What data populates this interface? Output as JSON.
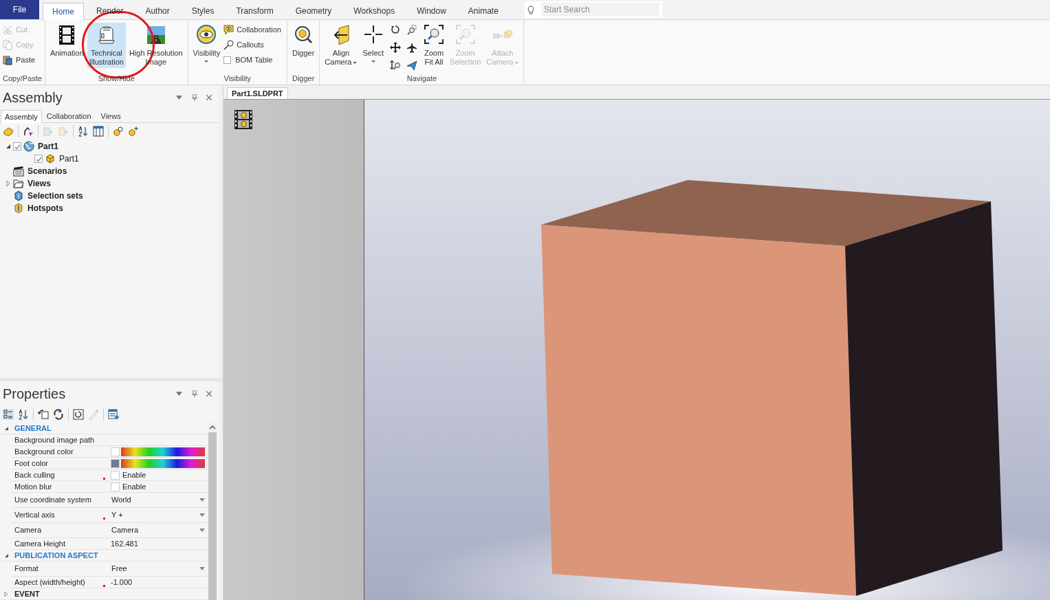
{
  "menu_tabs": [
    {
      "label": "File",
      "kind": "file"
    },
    {
      "label": "Home",
      "kind": "tab",
      "selected": true
    },
    {
      "label": "Render",
      "kind": "tab",
      "selected": false
    },
    {
      "label": "Author",
      "kind": "tab",
      "selected": false
    },
    {
      "label": "Styles",
      "kind": "tab",
      "selected": false
    },
    {
      "label": "Transform",
      "kind": "tab",
      "selected": false
    },
    {
      "label": "Geometry",
      "kind": "tab",
      "selected": false
    },
    {
      "label": "Workshops",
      "kind": "tab",
      "selected": false
    },
    {
      "label": "Window",
      "kind": "tab",
      "selected": false
    },
    {
      "label": "Animate",
      "kind": "tab",
      "selected": false
    }
  ],
  "search": {
    "placeholder": "Start Search"
  },
  "ribbon_groups": [
    {
      "label": "Copy/Paste",
      "items": [
        {
          "kind": "small",
          "label": "Cut",
          "disabled": true
        },
        {
          "kind": "small",
          "label": "Copy",
          "disabled": true
        },
        {
          "kind": "small",
          "label": "Paste",
          "disabled": false
        }
      ]
    },
    {
      "label": "Show/Hide",
      "items": [
        {
          "kind": "large",
          "label": "Animation",
          "disabled": false,
          "selected": false,
          "dropdown": false
        },
        {
          "kind": "large",
          "label": "Technical\nIllustration",
          "disabled": false,
          "selected": true,
          "dropdown": false
        },
        {
          "kind": "large",
          "label": "High Resolution\nImage",
          "disabled": false,
          "selected": false,
          "dropdown": false
        }
      ]
    },
    {
      "label": "Visibility",
      "items": [
        {
          "kind": "large",
          "label": "Visibility",
          "disabled": false,
          "selected": false,
          "dropdown": true
        },
        {
          "kind": "small",
          "label": "Collaboration",
          "disabled": false
        },
        {
          "kind": "small",
          "label": "Callouts",
          "disabled": false
        },
        {
          "kind": "checkbox",
          "label": "BOM Table",
          "checked": false
        }
      ]
    },
    {
      "label": "Digger",
      "items": [
        {
          "kind": "large",
          "label": "Digger",
          "disabled": false,
          "selected": false,
          "dropdown": false
        }
      ]
    },
    {
      "label": "Navigate",
      "items": [
        {
          "kind": "large",
          "label": "Align\nCamera",
          "disabled": false,
          "selected": false,
          "dropdown": true
        },
        {
          "kind": "large",
          "label": "Select",
          "disabled": false,
          "selected": false,
          "dropdown": true
        },
        {
          "kind": "tool-grid"
        },
        {
          "kind": "large",
          "label": "Zoom\nFit All",
          "disabled": false,
          "selected": false,
          "dropdown": false
        },
        {
          "kind": "large",
          "label": "Zoom\nSelection",
          "disabled": true,
          "selected": false,
          "dropdown": false
        },
        {
          "kind": "large",
          "label": "Attach\nCamera",
          "disabled": true,
          "selected": false,
          "dropdown": true
        }
      ]
    }
  ],
  "assembly_panel": {
    "title": "Assembly",
    "tabs": [
      {
        "label": "Assembly",
        "selected": true
      },
      {
        "label": "Collaboration",
        "selected": false
      },
      {
        "label": "Views",
        "selected": false
      }
    ],
    "tree": [
      {
        "label": "Part1",
        "expanded": true,
        "checked": true,
        "children": [
          {
            "label": "Part1",
            "checked": true
          }
        ]
      },
      {
        "label": "Scenarios"
      },
      {
        "label": "Views",
        "expanded": false
      },
      {
        "label": "Selection sets"
      },
      {
        "label": "Hotspots"
      }
    ]
  },
  "properties_panel": {
    "title": "Properties",
    "sections": [
      {
        "label": "GENERAL",
        "expanded": true,
        "rows": [
          {
            "name": "Background image path",
            "kind": "text",
            "modified": false
          },
          {
            "name": "Background color",
            "kind": "color",
            "color": "#ffffff",
            "modified": false
          },
          {
            "name": "Foot color",
            "kind": "color",
            "color": "#737a92",
            "modified": false
          },
          {
            "name": "Back culling",
            "kind": "checkbox",
            "value": "Enable",
            "checked": false,
            "modified": true
          },
          {
            "name": "Motion blur",
            "kind": "checkbox",
            "value": "Enable",
            "checked": false,
            "modified": false
          },
          {
            "name": "Use coordinate system",
            "kind": "dropdown",
            "value": "World",
            "modified": false
          },
          {
            "name": "Vertical axis",
            "kind": "dropdown",
            "value": "Y +",
            "modified": true
          },
          {
            "name": "Camera",
            "kind": "dropdown",
            "value": "Camera",
            "modified": false
          },
          {
            "name": "Camera Height",
            "kind": "text",
            "value": "162.481",
            "modified": false
          }
        ]
      },
      {
        "label": "PUBLICATION ASPECT",
        "expanded": true,
        "rows": [
          {
            "name": "Format",
            "kind": "dropdown",
            "value": "Free",
            "modified": false
          },
          {
            "name": "Aspect (width/height)",
            "kind": "text",
            "value": "-1.000",
            "modified": true
          }
        ]
      },
      {
        "label": "EVENT",
        "expanded": false
      }
    ]
  },
  "document_tab": {
    "label": "Part1.SLDPRT"
  }
}
